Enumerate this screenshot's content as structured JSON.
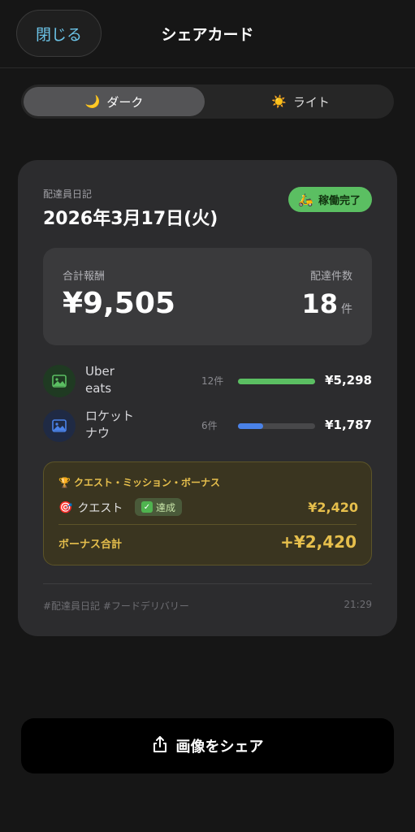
{
  "header": {
    "close_label": "閉じる",
    "title": "シェアカード"
  },
  "theme": {
    "dark_icon": "🌙",
    "dark_label": "ダーク",
    "light_icon": "☀️",
    "light_label": "ライト",
    "selected": "ダーク"
  },
  "card": {
    "label": "配達員日記",
    "date": "2026年3月17日(火)",
    "status": "稼働完了",
    "status_icon": "scooter-icon",
    "totals": {
      "revenue_label": "合計報酬",
      "revenue_value": "¥9,505",
      "count_label": "配達件数",
      "count_value": "18",
      "count_unit": "件"
    },
    "services": [
      {
        "name": "Uber eats",
        "count": "12件",
        "amount": "¥5,298",
        "bar_fraction": 1.0,
        "color": "#5bbf62",
        "icon_bg": "#1f3a22"
      },
      {
        "name": "ロケットナウ",
        "count": "6件",
        "amount": "¥1,787",
        "bar_fraction": 0.33,
        "color": "#4a82e8",
        "icon_bg": "#1f2a44"
      }
    ],
    "quest": {
      "title": "クエスト・ミッション・ボーナス",
      "title_icon": "🏆",
      "item_label": "クエスト",
      "item_icon": "🎯",
      "item_badge": "達成",
      "item_amount": "¥2,420",
      "bonus_label": "ボーナス合計",
      "bonus_value": "+¥2,420"
    },
    "hashtags": "#配達員日記 #フードデリバリー",
    "time": "21:29"
  },
  "share": {
    "label": "画像をシェア",
    "icon": "share-icon"
  },
  "colors": {
    "accent": "#6cc4e8",
    "status_green": "#5bbf62",
    "gold": "#e6bf4c",
    "blue": "#4a82e8"
  }
}
